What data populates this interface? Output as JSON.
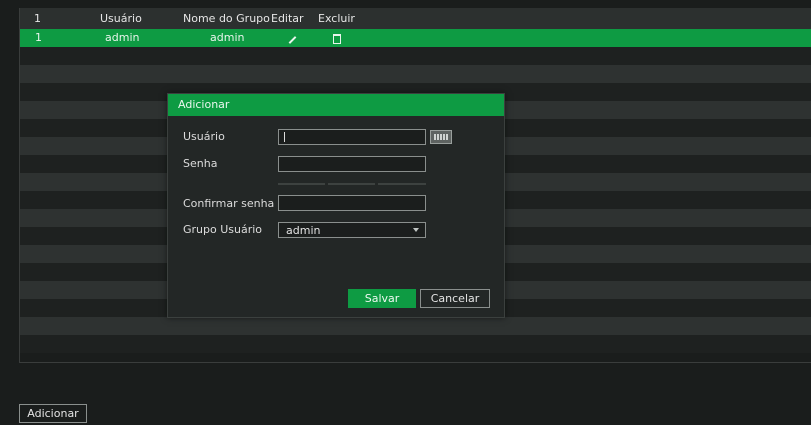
{
  "table": {
    "headers": [
      "1",
      "Usuário",
      "Nome do Grupo",
      "Editar",
      "Excluir"
    ],
    "rows": [
      {
        "index": "1",
        "user": "admin",
        "group": "admin",
        "edit_icon": "pencil-icon",
        "delete_icon": "trash-icon"
      }
    ]
  },
  "dialog": {
    "title": "Adicionar",
    "user_label": "Usuário",
    "user_value": "",
    "password_label": "Senha",
    "confirm_label": "Confirmar senha",
    "group_label": "Grupo Usuário",
    "group_selected": "admin",
    "save_label": "Salvar",
    "cancel_label": "Cancelar"
  },
  "footer": {
    "add_label": "Adicionar"
  },
  "colors": {
    "accent": "#0e9b43",
    "background": "#1a1d1c"
  }
}
